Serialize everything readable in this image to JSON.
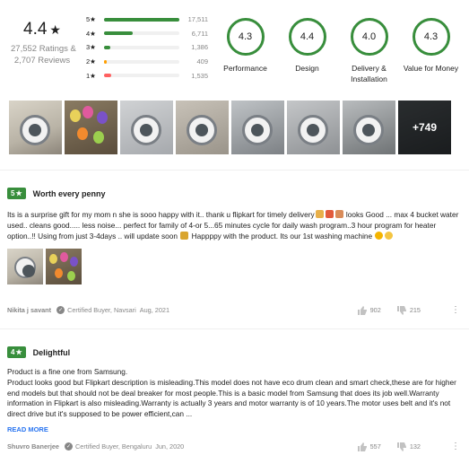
{
  "summary": {
    "rating": "4.4",
    "star": "★",
    "ratings_text": "27,552 Ratings &",
    "reviews_text": "2,707 Reviews"
  },
  "distribution": [
    {
      "label": "5★",
      "count": "17,511",
      "fraction": 1.0,
      "color": "#388e3c"
    },
    {
      "label": "4★",
      "count": "6,711",
      "fraction": 0.38,
      "color": "#388e3c"
    },
    {
      "label": "3★",
      "count": "1,386",
      "fraction": 0.08,
      "color": "#388e3c"
    },
    {
      "label": "2★",
      "count": "409",
      "fraction": 0.03,
      "color": "#ff9f00"
    },
    {
      "label": "1★",
      "count": "1,535",
      "fraction": 0.09,
      "color": "#ff6161"
    }
  ],
  "aspects": [
    {
      "score": "4.3",
      "label": "Performance"
    },
    {
      "score": "4.4",
      "label": "Design"
    },
    {
      "score": "4.0",
      "label": "Delivery &\nInstallation"
    },
    {
      "score": "4.3",
      "label": "Value for Money"
    }
  ],
  "gallery": {
    "more_label": "+749"
  },
  "reviews": [
    {
      "rating": "5",
      "star": "★",
      "title": "Worth every penny",
      "text_1": "Its is a surprise gift for my mom n she is sooo happy with it.. thank u flipkart for timely delivery",
      "text_2": " looks Good ... max 4 bucket water used.. cleans good..... less noise... perfect for family of 4-or 5...65 minutes cycle for daily wash program..3 hour program for heater option..!! Using from just 3-4days .. will update soon ",
      "text_3": " Happppy with the product. Its our 1st washing machine ",
      "author": "Nikita j savant",
      "certified": "Certified Buyer, Navsari",
      "date": "Aug, 2021",
      "likes": "902",
      "dislikes": "215"
    },
    {
      "rating": "4",
      "star": "★",
      "title": "Delightful",
      "text": "Product is a fine one from Samsung.\nProduct looks good but Flipkart description is misleading.This model does not have eco drum clean and smart check,these are for higher end models but that should not be deal breaker for most people.This is a basic model from Samsung that does its job well.Warranty information in Flipkart is also misleading.Warranty is actually 3 years and motor warranty is of 10 years.The motor uses belt and it's not direct drive but it's supposed to be power efficient,can ...",
      "read_more": "READ MORE",
      "author": "Shuvro Banerjee",
      "certified": "Certified Buyer, Bengaluru",
      "date": "Jun, 2020",
      "likes": "557",
      "dislikes": "132"
    }
  ],
  "colors": {
    "accent_green": "#388e3c",
    "link_blue": "#2874f0",
    "muted_grey": "#878787"
  }
}
